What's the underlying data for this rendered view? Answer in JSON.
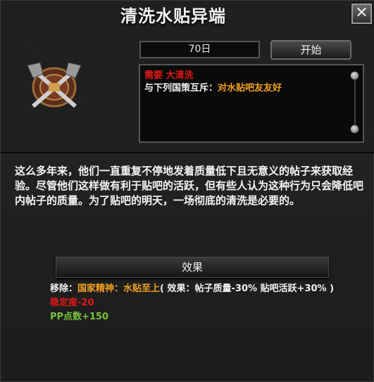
{
  "window": {
    "title": "清洗水贴异端",
    "close_symbol": "✕"
  },
  "controls": {
    "duration": "70日",
    "start_label": "开始"
  },
  "emblem": {
    "icon": "crossed-axes-shield-emblem"
  },
  "info": {
    "requirement_label": "需要",
    "requirement_value": "大清洗",
    "exclusive_label": "与下列国策互斥：",
    "exclusive_value": "对水贴吧友友好"
  },
  "description": "这么多年来，他们一直重复不停地发着质量低下且无意义的帖子来获取经验。尽管他们这样做有利于贴吧的活跃，但有些人认为这种行为只会降低吧内帖子的质量。为了贴吧的明天，一场彻底的清洗是必要的。",
  "effects": {
    "header": "效果",
    "remove_label": "移除：",
    "remove_spirit_label": "国家精神：",
    "remove_spirit_value": "水贴至上",
    "remove_detail": "( 效果：帖子质量-30% 贴吧活跃+30% )",
    "stability": "稳定度-20",
    "pp": "PP点数+150"
  },
  "colors": {
    "red": "#e01818",
    "gold": "#f0a020",
    "green": "#79c23c",
    "panel": "#1e1e1e"
  }
}
